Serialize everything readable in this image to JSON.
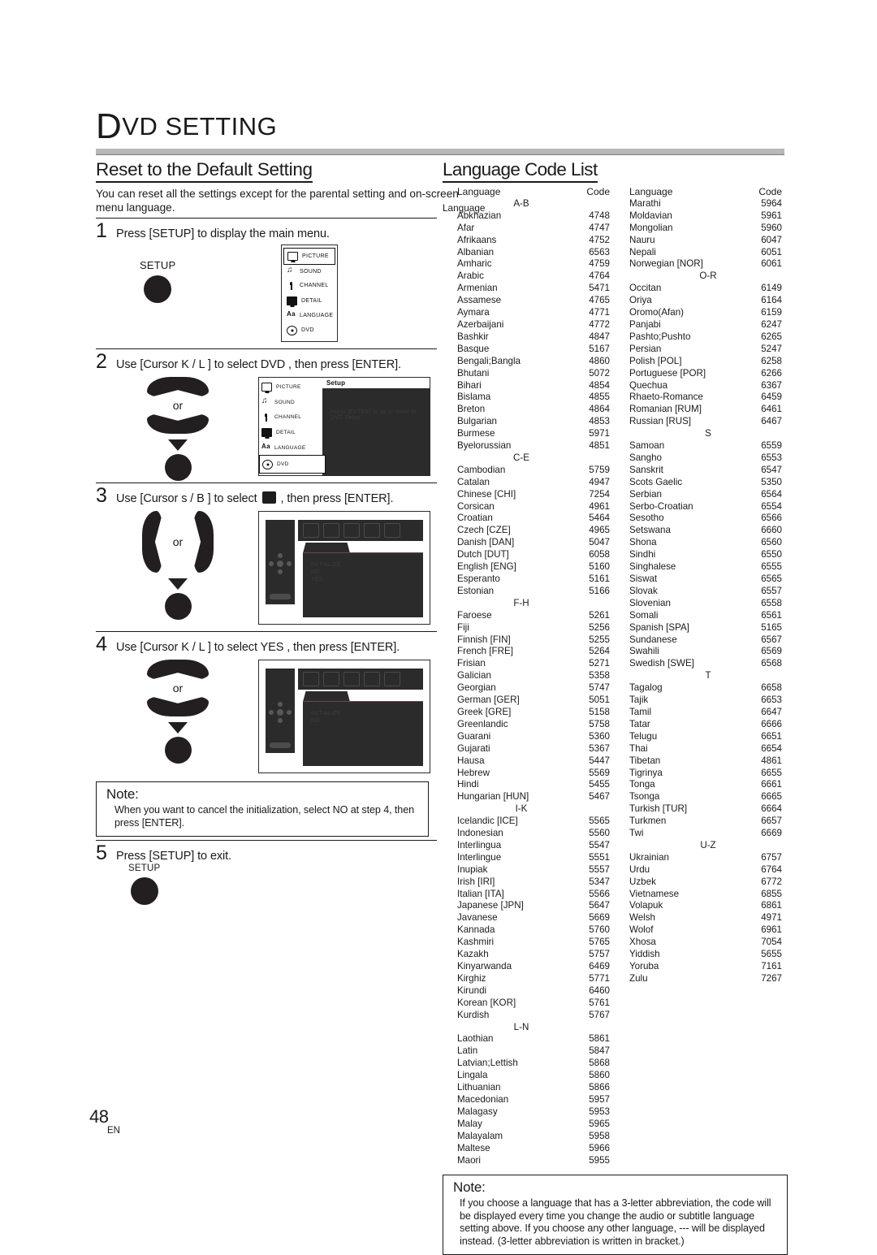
{
  "header": {
    "chapter_dropcap": "D",
    "chapter_rest": "VD  SETTING"
  },
  "left": {
    "section_title": "Reset to the Default Setting",
    "intro": "You can reset all the settings except for the parental setting and on-screen menu language.",
    "steps": [
      {
        "num": "1",
        "text": "Press [SETUP] to display the main menu.",
        "setup_key_label": "SETUP"
      },
      {
        "num": "2",
        "text_a": "Use [Cursor ",
        "text_k": "K",
        "text_sl": " / ",
        "text_l": "L",
        "text_b": " ] to select  DVD , then press [ENTER].",
        "or_label": "or",
        "osd": {
          "setup_title": "Setup",
          "setup_hint": "Press [ENTER] to go to move to DVD Setup",
          "menu_items": [
            "PICTURE",
            "SOUND",
            "CHANNEL",
            "DETAIL",
            "LANGUAGE",
            "DVD"
          ],
          "selected": "DVD"
        }
      },
      {
        "num": "3",
        "text_a": "Use [Cursor ",
        "text_k": "s",
        "text_sl": " / ",
        "text_l": "B",
        "text_b": " ] to select ",
        "text_c": " , then press [ENTER].",
        "or_label": "or",
        "osd": {
          "lines": [
            "INITIALIZE",
            "NO",
            "YES"
          ]
        }
      },
      {
        "num": "4",
        "text_a": "Use [Cursor ",
        "text_k": "K",
        "text_sl": " / ",
        "text_l": "L",
        "text_b": " ] to select  YES , then press [ENTER].",
        "or_label": "or",
        "osd": {
          "lines": [
            "INITIALIZE",
            "NO"
          ]
        }
      },
      {
        "num": "5",
        "text": "Press [SETUP] to exit.",
        "setup_key_label": "SETUP"
      }
    ],
    "note": {
      "title": "Note:",
      "body": "When you want to cancel the initialization, select  NO  at step 4, then press [ENTER]."
    }
  },
  "right": {
    "section_title": "Language Code List",
    "bleed_text": "Language",
    "columns": [
      {
        "header_name": "Language",
        "header_code": "Code",
        "entries": [
          {
            "group": "A-B"
          },
          {
            "name": "Abkhazian",
            "code": "4748"
          },
          {
            "name": "Afar",
            "code": "4747"
          },
          {
            "name": "Afrikaans",
            "code": "4752"
          },
          {
            "name": "Albanian",
            "code": "6563"
          },
          {
            "name": "Amharic",
            "code": "4759"
          },
          {
            "name": "Arabic",
            "code": "4764"
          },
          {
            "name": "Armenian",
            "code": "5471"
          },
          {
            "name": "Assamese",
            "code": "4765"
          },
          {
            "name": "Aymara",
            "code": "4771"
          },
          {
            "name": "Azerbaijani",
            "code": "4772"
          },
          {
            "name": "Bashkir",
            "code": "4847"
          },
          {
            "name": "Basque",
            "code": "5167"
          },
          {
            "name": "Bengali;Bangla",
            "code": "4860"
          },
          {
            "name": "Bhutani",
            "code": "5072"
          },
          {
            "name": "Bihari",
            "code": "4854"
          },
          {
            "name": "Bislama",
            "code": "4855"
          },
          {
            "name": "Breton",
            "code": "4864"
          },
          {
            "name": "Bulgarian",
            "code": "4853"
          },
          {
            "name": "Burmese",
            "code": "5971"
          },
          {
            "name": "Byelorussian",
            "code": "4851"
          },
          {
            "group": "C-E"
          },
          {
            "name": "Cambodian",
            "code": "5759"
          },
          {
            "name": "Catalan",
            "code": "4947"
          },
          {
            "name": "Chinese [CHI]",
            "code": "7254"
          },
          {
            "name": "Corsican",
            "code": "4961"
          },
          {
            "name": "Croatian",
            "code": "5464"
          },
          {
            "name": "Czech [CZE]",
            "code": "4965"
          },
          {
            "name": "Danish [DAN]",
            "code": "5047"
          },
          {
            "name": "Dutch [DUT]",
            "code": "6058"
          },
          {
            "name": "English [ENG]",
            "code": "5160"
          },
          {
            "name": "Esperanto",
            "code": "5161"
          },
          {
            "name": "Estonian",
            "code": "5166"
          },
          {
            "group": "F-H"
          },
          {
            "name": "Faroese",
            "code": "5261"
          },
          {
            "name": "Fiji",
            "code": "5256"
          },
          {
            "name": "Finnish [FIN]",
            "code": "5255"
          },
          {
            "name": "French [FRE]",
            "code": "5264"
          },
          {
            "name": "Frisian",
            "code": "5271"
          },
          {
            "name": "Galician",
            "code": "5358"
          },
          {
            "name": "Georgian",
            "code": "5747"
          },
          {
            "name": "German [GER]",
            "code": "5051"
          },
          {
            "name": "Greek [GRE]",
            "code": "5158"
          },
          {
            "name": "Greenlandic",
            "code": "5758"
          },
          {
            "name": "Guarani",
            "code": "5360"
          },
          {
            "name": "Gujarati",
            "code": "5367"
          },
          {
            "name": "Hausa",
            "code": "5447"
          },
          {
            "name": "Hebrew",
            "code": "5569"
          },
          {
            "name": "Hindi",
            "code": "5455"
          },
          {
            "name": "Hungarian [HUN]",
            "code": "5467"
          },
          {
            "group": "I-K"
          },
          {
            "name": "Icelandic [ICE]",
            "code": "5565"
          },
          {
            "name": "Indonesian",
            "code": "5560"
          },
          {
            "name": "Interlingua",
            "code": "5547"
          },
          {
            "name": "Interlingue",
            "code": "5551"
          },
          {
            "name": "Inupiak",
            "code": "5557"
          },
          {
            "name": "Irish [IRI]",
            "code": "5347"
          },
          {
            "name": "Italian [ITA]",
            "code": "5566"
          },
          {
            "name": "Japanese [JPN]",
            "code": "5647"
          },
          {
            "name": "Javanese",
            "code": "5669"
          },
          {
            "name": "Kannada",
            "code": "5760"
          },
          {
            "name": "Kashmiri",
            "code": "5765"
          },
          {
            "name": "Kazakh",
            "code": "5757"
          },
          {
            "name": "Kinyarwanda",
            "code": "6469"
          },
          {
            "name": "Kirghiz",
            "code": "5771"
          },
          {
            "name": "Kirundi",
            "code": "6460"
          },
          {
            "name": "Korean [KOR]",
            "code": "5761"
          },
          {
            "name": "Kurdish",
            "code": "5767"
          },
          {
            "group": "L-N"
          },
          {
            "name": "Laothian",
            "code": "5861"
          },
          {
            "name": "Latin",
            "code": "5847"
          },
          {
            "name": "Latvian;Lettish",
            "code": "5868"
          },
          {
            "name": "Lingala",
            "code": "5860"
          },
          {
            "name": "Lithuanian",
            "code": "5866"
          },
          {
            "name": "Macedonian",
            "code": "5957"
          },
          {
            "name": "Malagasy",
            "code": "5953"
          },
          {
            "name": "Malay",
            "code": "5965"
          },
          {
            "name": "Malayalam",
            "code": "5958"
          },
          {
            "name": "Maltese",
            "code": "5966"
          },
          {
            "name": "Maori",
            "code": "5955"
          }
        ]
      },
      {
        "header_name": "Language",
        "header_code": "Code",
        "entries": [
          {
            "name": "Marathi",
            "code": "5964"
          },
          {
            "name": "Moldavian",
            "code": "5961"
          },
          {
            "name": "Mongolian",
            "code": "5960"
          },
          {
            "name": "Nauru",
            "code": "6047"
          },
          {
            "name": "Nepali",
            "code": "6051"
          },
          {
            "name": "Norwegian [NOR]",
            "code": "6061"
          },
          {
            "group": "O-R"
          },
          {
            "name": "Occitan",
            "code": "6149"
          },
          {
            "name": "Oriya",
            "code": "6164"
          },
          {
            "name": "Oromo(Afan)",
            "code": "6159"
          },
          {
            "name": "Panjabi",
            "code": "6247"
          },
          {
            "name": "Pashto;Pushto",
            "code": "6265"
          },
          {
            "name": "Persian",
            "code": "5247"
          },
          {
            "name": "Polish [POL]",
            "code": "6258"
          },
          {
            "name": "Portuguese [POR]",
            "code": "6266"
          },
          {
            "name": "Quechua",
            "code": "6367"
          },
          {
            "name": "Rhaeto-Romance",
            "code": "6459"
          },
          {
            "name": "Romanian [RUM]",
            "code": "6461"
          },
          {
            "name": "Russian [RUS]",
            "code": "6467"
          },
          {
            "group": "S"
          },
          {
            "name": "Samoan",
            "code": "6559"
          },
          {
            "name": "Sangho",
            "code": "6553"
          },
          {
            "name": "Sanskrit",
            "code": "6547"
          },
          {
            "name": "Scots Gaelic",
            "code": "5350"
          },
          {
            "name": "Serbian",
            "code": "6564"
          },
          {
            "name": "Serbo-Croatian",
            "code": "6554"
          },
          {
            "name": "Sesotho",
            "code": "6566"
          },
          {
            "name": "Setswana",
            "code": "6660"
          },
          {
            "name": "Shona",
            "code": "6560"
          },
          {
            "name": "Sindhi",
            "code": "6550"
          },
          {
            "name": "Singhalese",
            "code": "6555"
          },
          {
            "name": "Siswat",
            "code": "6565"
          },
          {
            "name": "Slovak",
            "code": "6557"
          },
          {
            "name": "Slovenian",
            "code": "6558"
          },
          {
            "name": "Somali",
            "code": "6561"
          },
          {
            "name": "Spanish [SPA]",
            "code": "5165"
          },
          {
            "name": "Sundanese",
            "code": "6567"
          },
          {
            "name": "Swahili",
            "code": "6569"
          },
          {
            "name": "Swedish [SWE]",
            "code": "6568"
          },
          {
            "group": "T"
          },
          {
            "name": "Tagalog",
            "code": "6658"
          },
          {
            "name": "Tajik",
            "code": "6653"
          },
          {
            "name": "Tamil",
            "code": "6647"
          },
          {
            "name": "Tatar",
            "code": "6666"
          },
          {
            "name": "Telugu",
            "code": "6651"
          },
          {
            "name": "Thai",
            "code": "6654"
          },
          {
            "name": "Tibetan",
            "code": "4861"
          },
          {
            "name": "Tigrinya",
            "code": "6655"
          },
          {
            "name": "Tonga",
            "code": "6661"
          },
          {
            "name": "Tsonga",
            "code": "6665"
          },
          {
            "name": "Turkish [TUR]",
            "code": "6664"
          },
          {
            "name": "Turkmen",
            "code": "6657"
          },
          {
            "name": "Twi",
            "code": "6669"
          },
          {
            "group": "U-Z"
          },
          {
            "name": "Ukrainian",
            "code": "6757"
          },
          {
            "name": "Urdu",
            "code": "6764"
          },
          {
            "name": "Uzbek",
            "code": "6772"
          },
          {
            "name": "Vietnamese",
            "code": "6855"
          },
          {
            "name": "Volapuk",
            "code": "6861"
          },
          {
            "name": "Welsh",
            "code": "4971"
          },
          {
            "name": "Wolof",
            "code": "6961"
          },
          {
            "name": "Xhosa",
            "code": "7054"
          },
          {
            "name": "Yiddish",
            "code": "5655"
          },
          {
            "name": "Yoruba",
            "code": "7161"
          },
          {
            "name": "Zulu",
            "code": "7267"
          }
        ]
      }
    ],
    "note": {
      "title": "Note:",
      "body": "If you choose a language that has a 3-letter abbreviation, the code will be displayed every time you change the audio or subtitle language setting above. If you choose any other language,  ---  will be displayed instead. (3-letter abbreviation is written in bracket.)"
    }
  },
  "footer": {
    "page_number": "48",
    "language_code": "EN"
  }
}
